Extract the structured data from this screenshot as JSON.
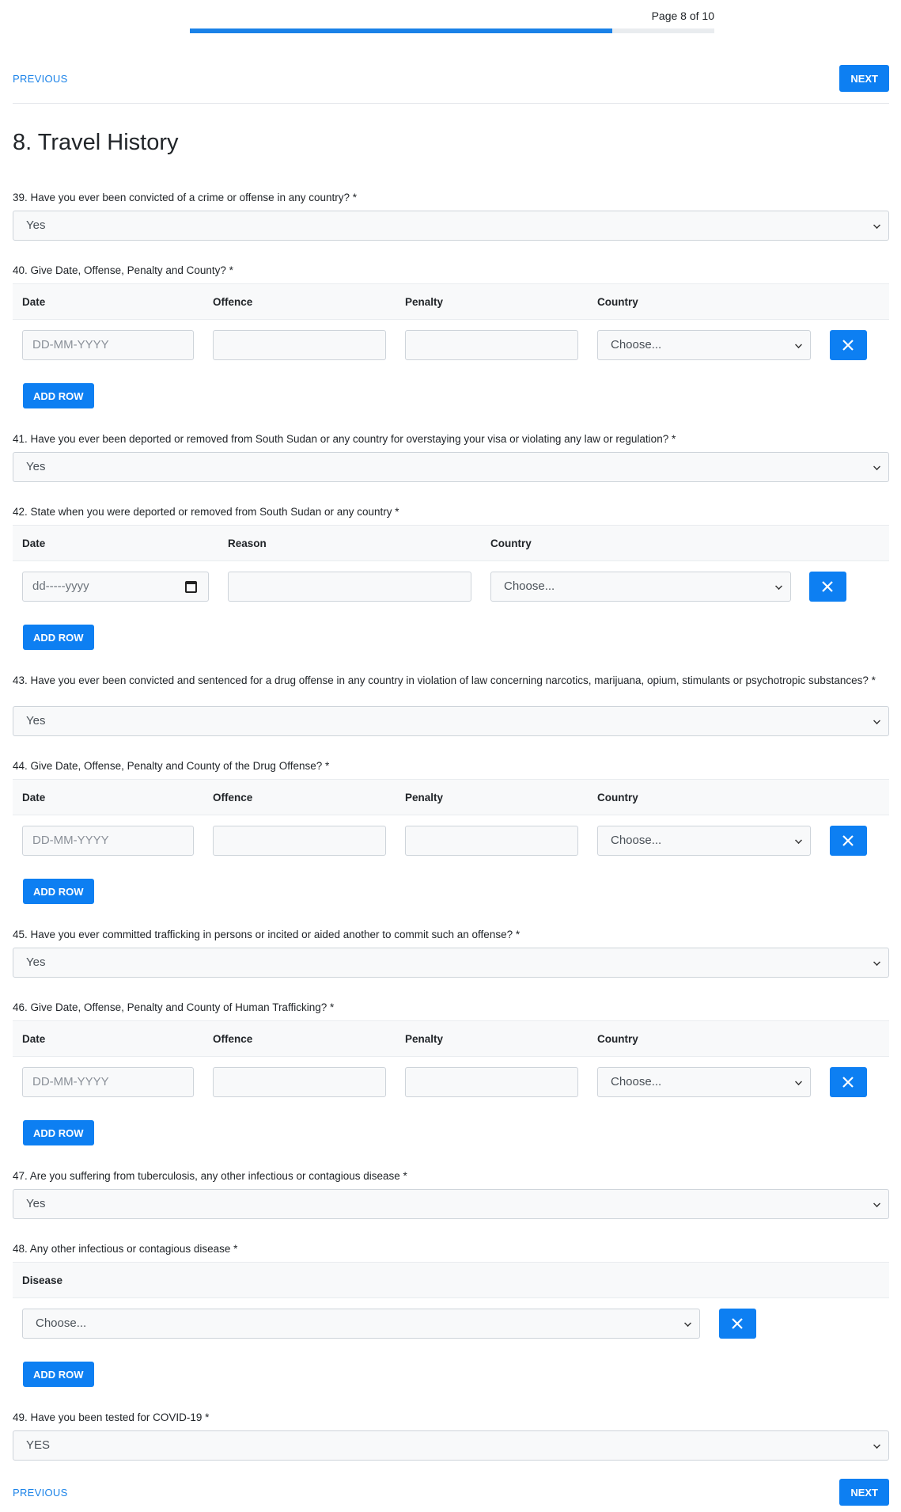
{
  "progress": {
    "text": "Page 8 of 10",
    "fraction": 0.805
  },
  "nav": {
    "previous_label": "PREVIOUS",
    "next_label": "NEXT"
  },
  "page_title": "8. Travel History",
  "common": {
    "yes": "Yes",
    "choose": "Choose...",
    "add_row": "ADD ROW",
    "date_placeholder": "DD-MM-YYYY",
    "date_native": "dd-----yyyy",
    "col_date": "Date",
    "col_offence": "Offence",
    "col_penalty": "Penalty",
    "col_country": "Country",
    "col_reason": "Reason",
    "col_disease": "Disease"
  },
  "questions": {
    "q39": "39. Have you ever been convicted of a crime or offense in any country? *",
    "q40": "40. Give Date, Offense, Penalty and County? *",
    "q41": "41. Have you ever been deported or removed from South Sudan or any country for overstaying your visa or violating any law or regulation? *",
    "q42": "42. State when you were deported or removed from South Sudan or any country *",
    "q43": "43. Have you ever been convicted and sentenced for a drug offense in any country in violation of law concerning narcotics, marijuana, opium, stimulants or psychotropic substances? *",
    "q44": "44. Give Date, Offense, Penalty and County of the Drug Offense? *",
    "q45": "45. Have you ever committed trafficking in persons or incited or aided another to commit such an offense? *",
    "q46": "46. Give Date, Offense, Penalty and County of Human Trafficking? *",
    "q47": "47. Are you suffering from tuberculosis, any other infectious or contagious disease *",
    "q48": "48. Any other infectious or contagious disease *",
    "q49": "49. Have you been tested for COVID-19 *"
  },
  "answers": {
    "q49": "YES"
  },
  "colors": {
    "primary": "#0d7ff2",
    "link": "#1a82e8"
  }
}
